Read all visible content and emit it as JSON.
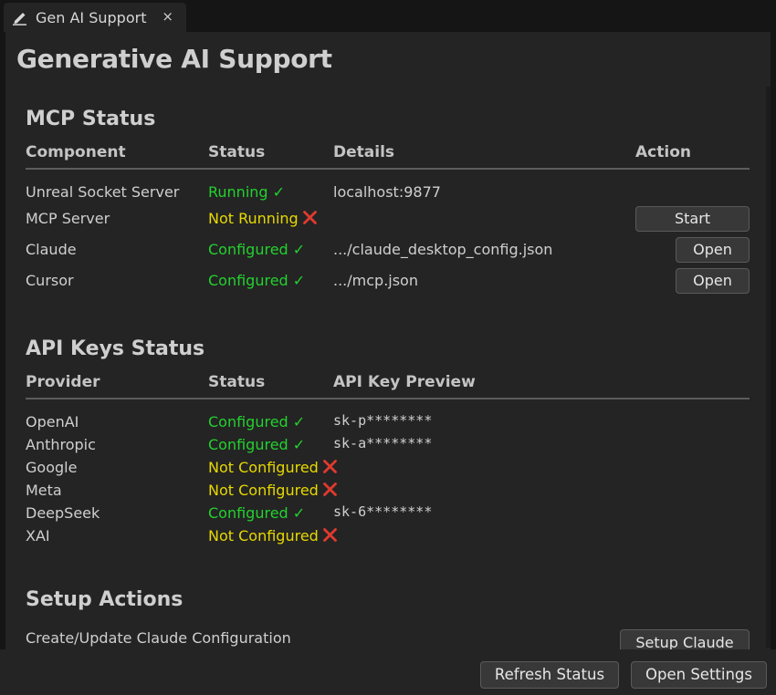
{
  "tab": {
    "title": "Gen AI Support",
    "close": "×"
  },
  "page_title": "Generative AI Support",
  "mcp": {
    "title": "MCP Status",
    "headers": {
      "component": "Component",
      "status": "Status",
      "details": "Details",
      "action": "Action"
    },
    "rows": [
      {
        "component": "Unreal Socket Server",
        "status": "Running ✓",
        "details": "localhost:9877",
        "action": ""
      },
      {
        "component": "MCP Server",
        "status": "Not Running",
        "details": "",
        "action": "Start"
      },
      {
        "component": "Claude",
        "status": "Configured ✓",
        "details": ".../claude_desktop_config.json",
        "action": "Open"
      },
      {
        "component": "Cursor",
        "status": "Configured ✓",
        "details": ".../mcp.json",
        "action": "Open"
      }
    ]
  },
  "api": {
    "title": "API Keys Status",
    "headers": {
      "provider": "Provider",
      "status": "Status",
      "preview": "API Key Preview"
    },
    "rows": [
      {
        "provider": "OpenAI",
        "status": "Configured ✓",
        "preview": "sk-p********"
      },
      {
        "provider": "Anthropic",
        "status": "Configured ✓",
        "preview": "sk-a********"
      },
      {
        "provider": "Google",
        "status": "Not Configured",
        "preview": ""
      },
      {
        "provider": "Meta",
        "status": "Not Configured",
        "preview": ""
      },
      {
        "provider": "DeepSeek",
        "status": "Configured ✓",
        "preview": "sk-6********"
      },
      {
        "provider": "XAI",
        "status": "Not Configured",
        "preview": ""
      }
    ]
  },
  "setup": {
    "title": "Setup Actions",
    "item_label": "Create/Update Claude Configuration",
    "button": "Setup Claude"
  },
  "footer": {
    "refresh": "Refresh Status",
    "settings": "Open Settings"
  },
  "colors": {
    "ok": "#23d12e",
    "warn": "#e7d800",
    "error": "#e03a2e",
    "background": "#242424"
  }
}
